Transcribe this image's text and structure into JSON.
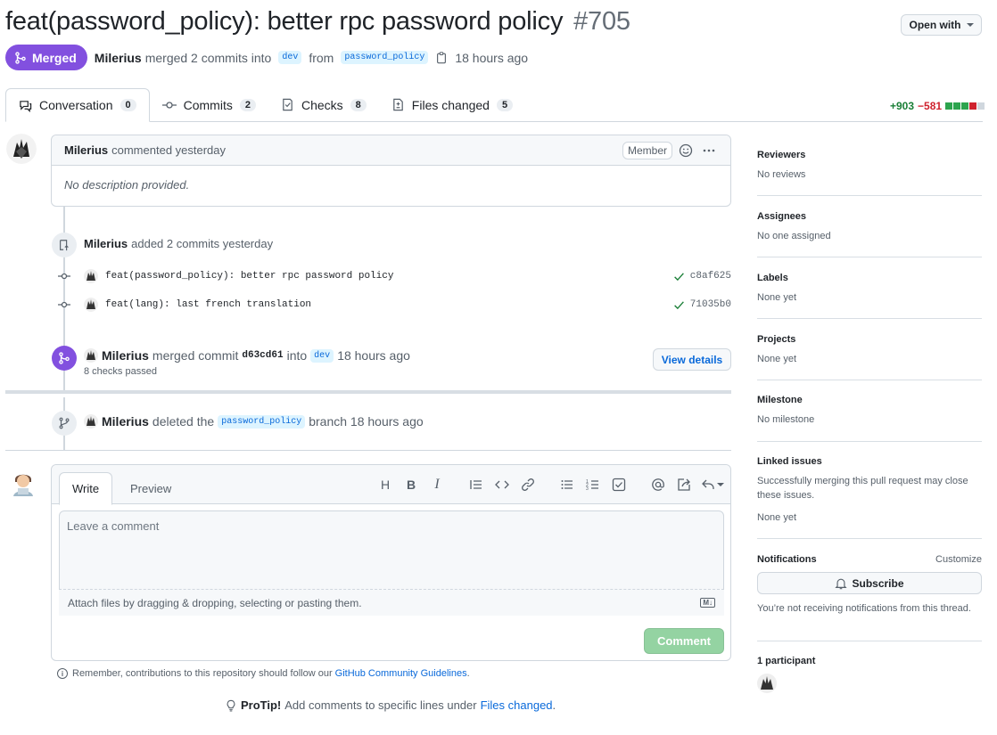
{
  "pr": {
    "title": "feat(password_policy): better rpc password policy",
    "number": "#705",
    "state": "Merged",
    "author": "Milerius",
    "merge_text": "merged 2 commits into",
    "base_branch": "dev",
    "from_text": "from",
    "head_branch": "password_policy",
    "time": "18 hours ago"
  },
  "open_with": "Open with",
  "tabs": [
    {
      "label": "Conversation",
      "count": "0"
    },
    {
      "label": "Commits",
      "count": "2"
    },
    {
      "label": "Checks",
      "count": "8"
    },
    {
      "label": "Files changed",
      "count": "5"
    }
  ],
  "diffstat": {
    "additions": "+903",
    "deletions": "−581"
  },
  "comment": {
    "author": "Milerius",
    "action": "commented yesterday",
    "badge": "Member",
    "body": "No description provided."
  },
  "commits_event": {
    "author": "Milerius",
    "text": "added 2 commits yesterday"
  },
  "commits": [
    {
      "message": "feat(password_policy): better rpc password policy",
      "sha": "c8af625"
    },
    {
      "message": "feat(lang): last french translation",
      "sha": "71035b0"
    }
  ],
  "merge_event": {
    "author": "Milerius",
    "text": "merged commit",
    "sha": "d63cd61",
    "into": "into",
    "branch": "dev",
    "time": "18 hours ago",
    "checks": "8 checks passed",
    "button": "View details"
  },
  "delete_event": {
    "author": "Milerius",
    "text": "deleted the",
    "branch": "password_policy",
    "suffix": "branch 18 hours ago"
  },
  "editor": {
    "tab_write": "Write",
    "tab_preview": "Preview",
    "placeholder": "Leave a comment",
    "attach": "Attach files by dragging & dropping, selecting or pasting them.",
    "submit": "Comment"
  },
  "remember": {
    "text": "Remember, contributions to this repository should follow our",
    "link": "GitHub Community Guidelines",
    "end": "."
  },
  "protip": {
    "label": "ProTip!",
    "text": "Add comments to specific lines under",
    "link": "Files changed",
    "end": "."
  },
  "sidebar": {
    "reviewers": {
      "title": "Reviewers",
      "value": "No reviews"
    },
    "assignees": {
      "title": "Assignees",
      "value": "No one assigned"
    },
    "labels": {
      "title": "Labels",
      "value": "None yet"
    },
    "projects": {
      "title": "Projects",
      "value": "None yet"
    },
    "milestone": {
      "title": "Milestone",
      "value": "No milestone"
    },
    "linked": {
      "title": "Linked issues",
      "desc": "Successfully merging this pull request may close these issues.",
      "value": "None yet"
    },
    "notifications": {
      "title": "Notifications",
      "customize": "Customize",
      "button": "Subscribe",
      "note": "You’re not receiving notifications from this thread."
    },
    "participants": {
      "title": "1 participant"
    }
  },
  "colors": {
    "merged": "#8250df",
    "link": "#0969da",
    "add": "#1a7f37",
    "del": "#cf222e"
  }
}
